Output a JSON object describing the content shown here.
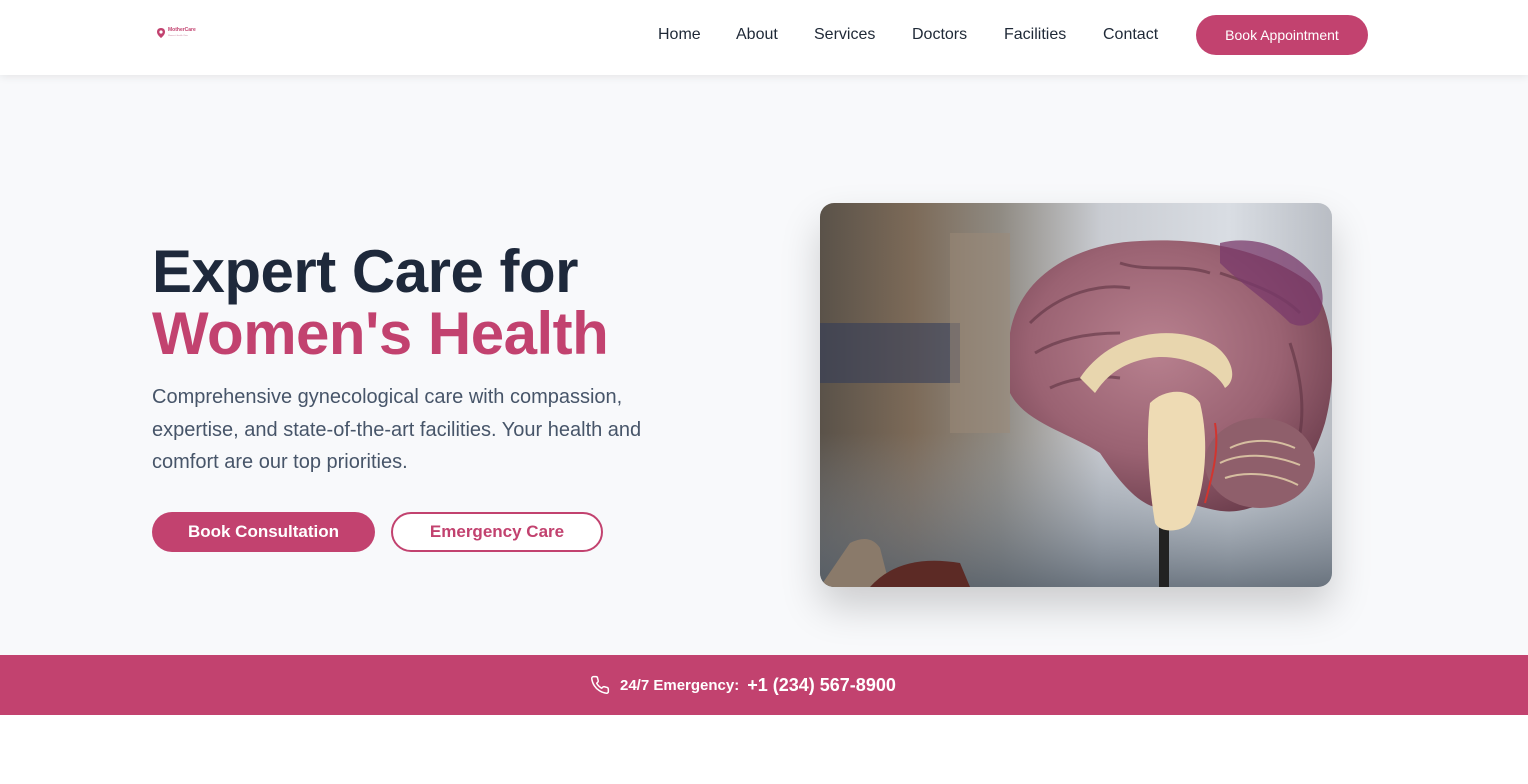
{
  "header": {
    "logo_text": "MotherCare",
    "logo_tagline": "Women's Health Clinic",
    "nav": [
      {
        "label": "Home"
      },
      {
        "label": "About"
      },
      {
        "label": "Services"
      },
      {
        "label": "Doctors"
      },
      {
        "label": "Facilities"
      },
      {
        "label": "Contact"
      }
    ],
    "cta_label": "Book Appointment"
  },
  "hero": {
    "headline_line1": "Expert Care for",
    "headline_line2": "Women's Health",
    "description": "Comprehensive gynecological care with compassion, expertise, and state-of-the-art facilities. Your health and comfort are our top priorities.",
    "primary_button": "Book Consultation",
    "secondary_button": "Emergency Care",
    "image_subject": "anatomical brain model"
  },
  "emergency": {
    "icon": "phone-icon",
    "label": "24/7 Emergency:",
    "phone": "+1 (234) 567-8900"
  },
  "colors": {
    "brand": "#c2426f",
    "heading": "#1e293b",
    "body_text": "#475569",
    "hero_bg": "#f8f9fb"
  }
}
